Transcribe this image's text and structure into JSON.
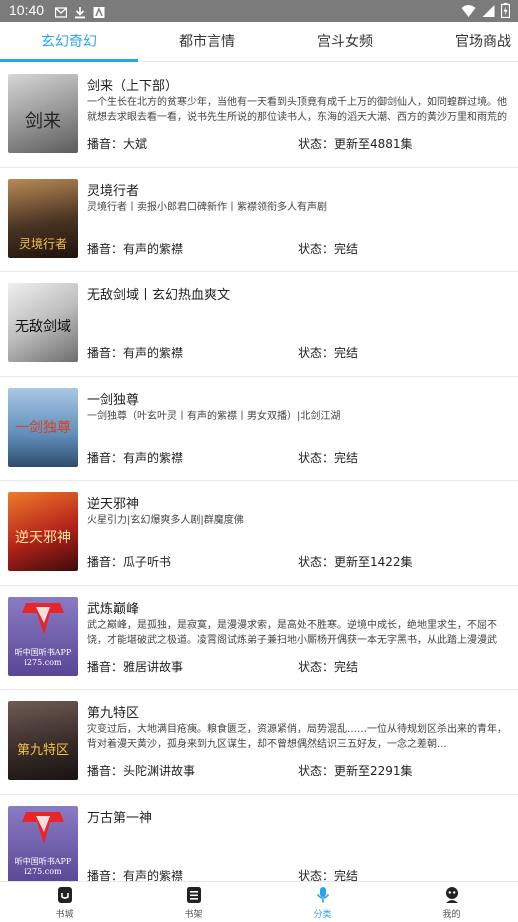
{
  "status_bar": {
    "time": "10:40"
  },
  "tabs": [
    {
      "label": "玄幻奇幻",
      "active": true
    },
    {
      "label": "都市言情",
      "active": false
    },
    {
      "label": "宫斗女频",
      "active": false
    },
    {
      "label": "官场商战",
      "active": false
    }
  ],
  "books": [
    {
      "title": "剑来（上下部）",
      "desc": "一个生长在北方的贫寒少年，当他有一天看到头顶竟有成千上万的御剑仙人，如同蝗群过境。他就想去求眼去看一看，说书先生所说的那位读书人，东海的滔天大潮、西方的黄沙万里和雨荒的巍...",
      "narrator": "播音：大斌",
      "state": "状态：更新至4881集",
      "cover_text": "剑来",
      "cover_color": "#b9b9b9"
    },
    {
      "title": "灵境行者",
      "desc": "灵境行者丨卖报小郎君口碑新作丨紫襟领衔多人有声剧",
      "narrator": "播音：有声的紫襟",
      "state": "状态：完结",
      "cover_text": "灵境行者",
      "cover_color": "#3b2a1c"
    },
    {
      "title": "无敌剑域丨玄幻热血爽文",
      "desc": "",
      "narrator": "播音：有声的紫襟",
      "state": "状态：完结",
      "cover_text": "无敌剑域",
      "cover_color": "#d9d9d9"
    },
    {
      "title": "一剑独尊",
      "desc": "一剑独尊（叶玄叶灵丨有声的紫襟丨男女双播）|北剑江湖",
      "narrator": "播音：有声的紫襟",
      "state": "状态：完结",
      "cover_text": "一剑独尊",
      "cover_color": "#6f9fc8"
    },
    {
      "title": "逆天邪神",
      "desc": "火星引力|玄幻爆爽多人剧|群魔度佛",
      "narrator": "播音：瓜子听书",
      "state": "状态：更新至1422集",
      "cover_text": "逆天邪神",
      "cover_color": "#c0321d"
    },
    {
      "title": "武炼巅峰",
      "desc": "武之巅峰，是孤独，是寂寞，是漫漫求索，是高处不胜寒。逆境中成长，绝地里求生，不屈不饶，才能堪破武之极道。凌霄阁试炼弟子兼扫地小厮杨开偶获一本无字黑书，从此踏上漫漫武道。",
      "narrator": "播音：雅居讲故事",
      "state": "状态：完结",
      "cover_text": "听中国听书APP i275.com",
      "cover_color": "#6a4fa0"
    },
    {
      "title": "第九特区",
      "desc": "灾变过后，大地满目疮痍。粮食匮乏，资源紧俏，局势混乱……一位从待规划区杀出来的青年，背对着漫天黄沙，孤身来到九区谋生，却不曾想偶然结识三五好友，一念之差朝...",
      "narrator": "播音：头陀渊讲故事",
      "state": "状态：更新至2291集",
      "cover_text": "第九特区",
      "cover_color": "#3a2d2a"
    },
    {
      "title": "万古第一神",
      "desc": "",
      "narrator": "播音：有声的紫襟",
      "state": "状态：完结",
      "cover_text": "听中国听书APP i275.com",
      "cover_color": "#6a4fa0"
    }
  ],
  "bottom_nav": [
    {
      "label": "书城",
      "icon": "bookstore-icon",
      "active": false
    },
    {
      "label": "书架",
      "icon": "bookshelf-icon",
      "active": false
    },
    {
      "label": "分类",
      "icon": "microphone-icon",
      "active": true
    },
    {
      "label": "我的",
      "icon": "profile-icon",
      "active": false
    }
  ],
  "colors": {
    "accent": "#29a3ea",
    "status_bar": "#7b7b7b"
  }
}
